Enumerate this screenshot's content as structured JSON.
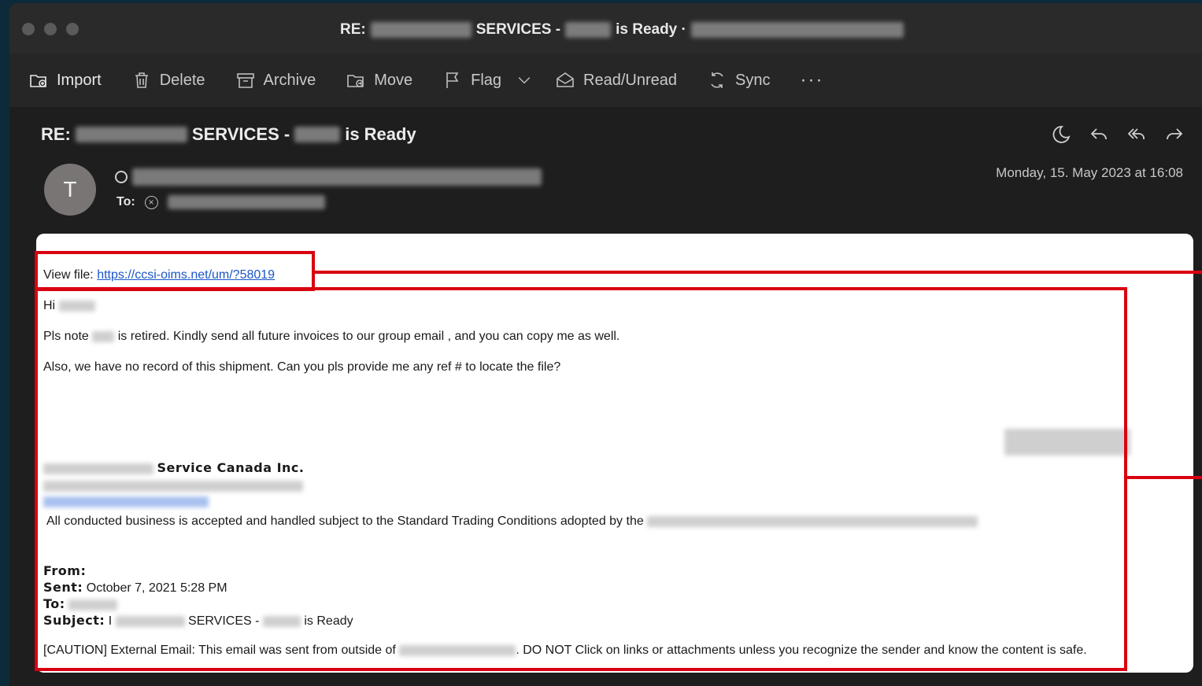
{
  "window": {
    "title_prefix": "RE:",
    "title_mid": "SERVICES -",
    "title_suffix": "is Ready ·"
  },
  "toolbar": {
    "items": [
      {
        "label": "Import",
        "icon": "import-icon"
      },
      {
        "label": "Delete",
        "icon": "trash-icon"
      },
      {
        "label": "Archive",
        "icon": "archive-icon"
      },
      {
        "label": "Move",
        "icon": "move-folder-icon"
      },
      {
        "label": "Flag",
        "icon": "flag-icon"
      },
      {
        "label": "Read/Unread",
        "icon": "envelope-open-icon"
      },
      {
        "label": "Sync",
        "icon": "sync-icon"
      }
    ],
    "more": "···"
  },
  "message": {
    "subject_prefix": "RE:",
    "subject_mid": "SERVICES -",
    "subject_suffix": "is Ready",
    "avatar_initial": "T",
    "to_label": "To:",
    "date": "Monday, 15. May 2023 at 16:08",
    "actions": [
      "snooze-moon-icon",
      "reply-icon",
      "reply-all-icon",
      "forward-icon"
    ]
  },
  "body": {
    "view_file_label": "View file:",
    "view_file_link": "https://ccsi-oims.net/um/?58019",
    "greeting": "Hi",
    "para1_a": "Pls note",
    "para1_b": "is retired. Kindly send all future invoices to our group email , and you can copy me as well.",
    "para2": "Also, we have no record of this shipment. Can you pls provide me any ref # to locate the file?",
    "company": "Service Canada Inc.",
    "terms": "All conducted business is accepted and handled subject to the Standard Trading Conditions adopted by the",
    "from_label": "From:",
    "sent_label": "Sent:",
    "sent_value": "October 7, 2021 5:28 PM",
    "to_label": "To:",
    "subject_label": "Subject:",
    "subject_value_a": "I",
    "subject_value_b": "SERVICES -",
    "subject_value_c": "is Ready",
    "caution_a": "[CAUTION] External Email: This email was sent from outside of",
    "caution_b": ". DO NOT Click on links or attachments unless you recognize the sender and know the content is safe."
  },
  "colors": {
    "highlight": "#d90010",
    "link": "#1a56c8"
  }
}
